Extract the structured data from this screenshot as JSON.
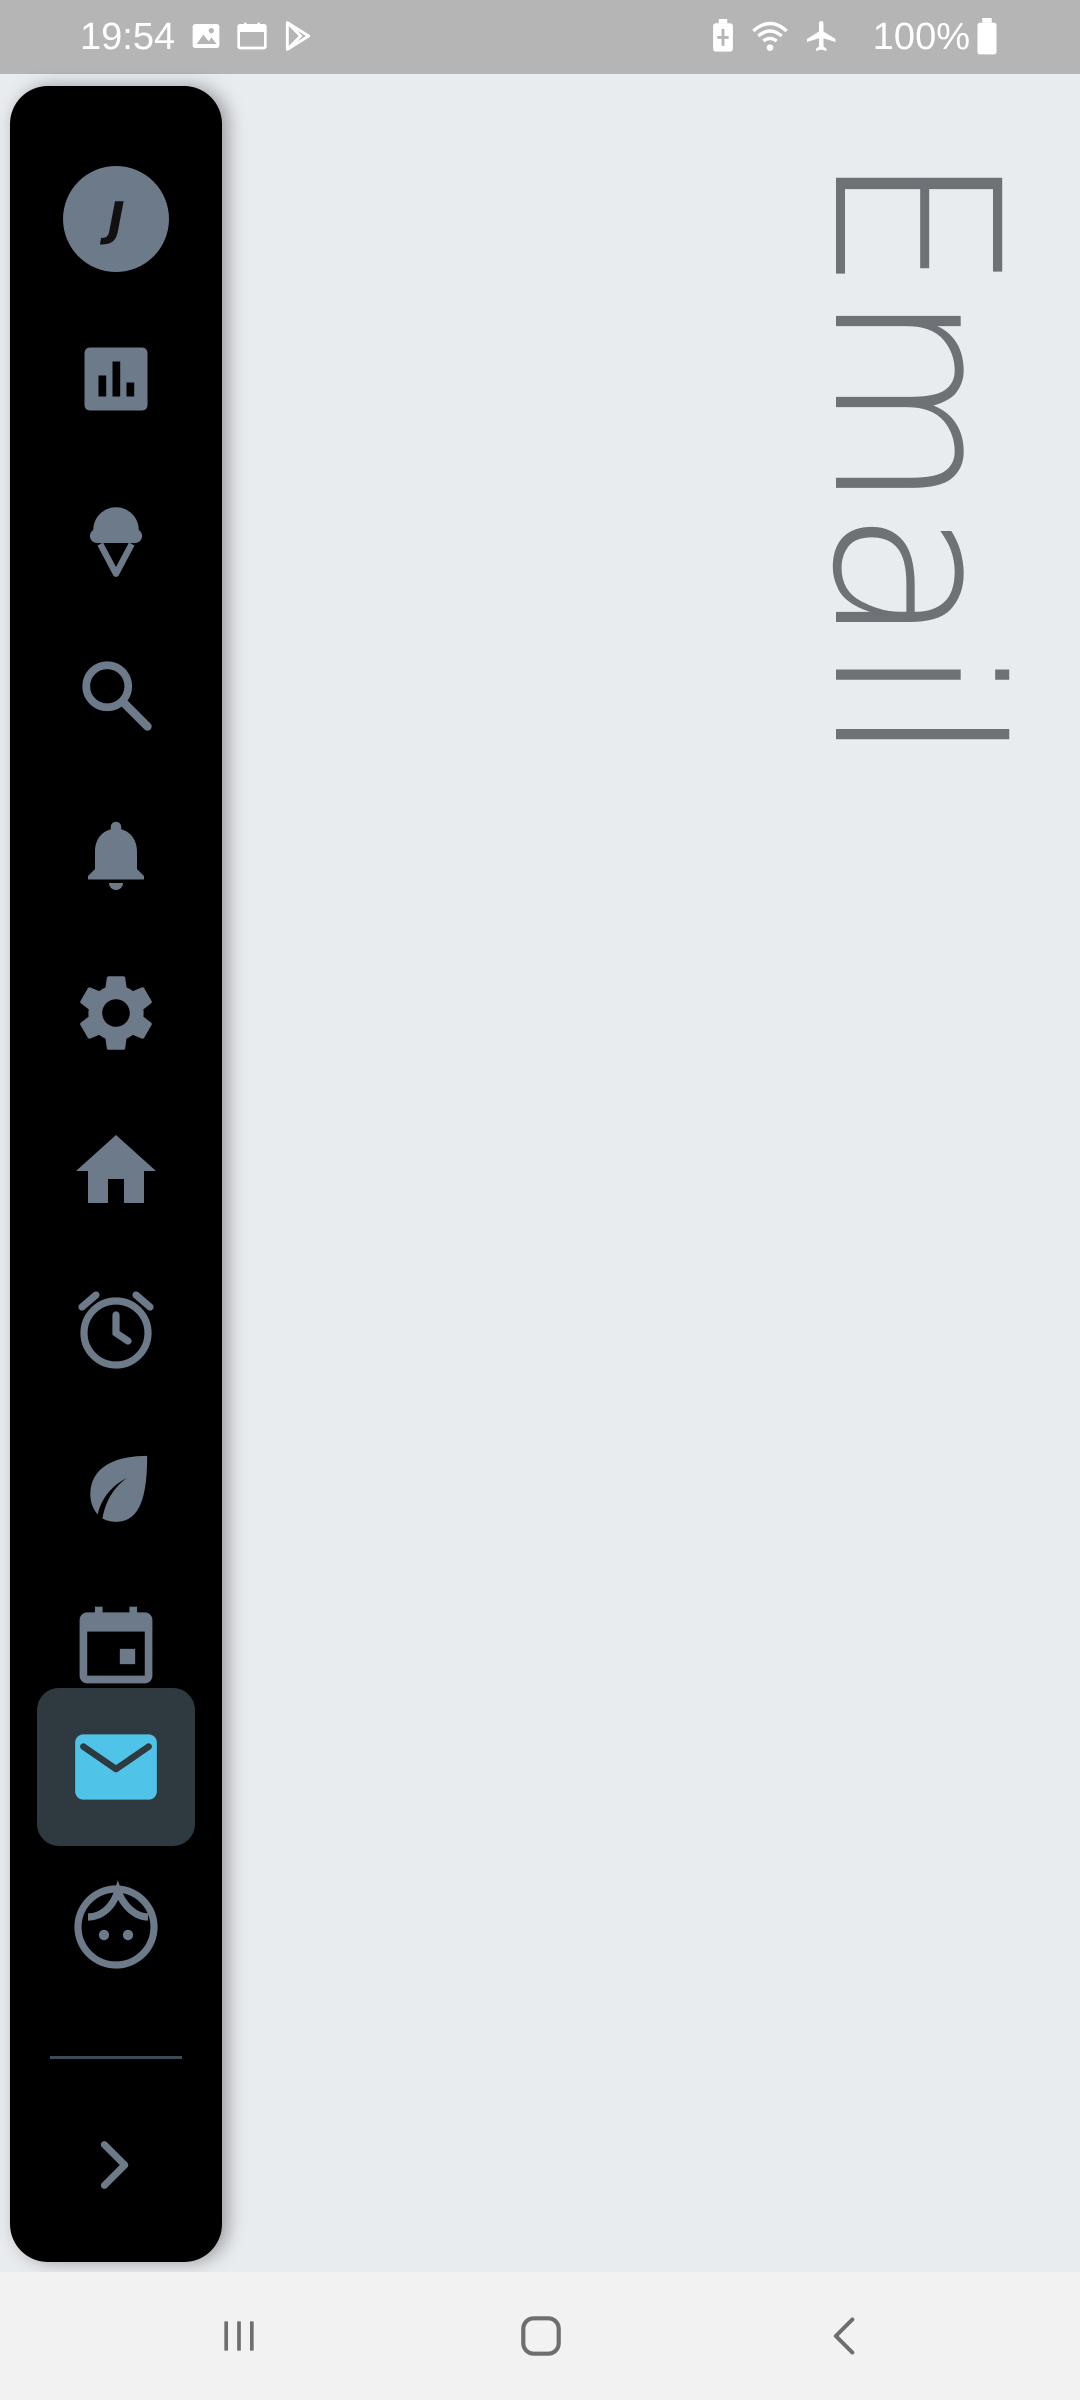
{
  "status_bar": {
    "time": "19:54",
    "battery_text": "100%",
    "left_icons": [
      "image-icon",
      "calendar-icon",
      "play-store-icon"
    ],
    "right_icons": [
      "battery-saver-icon",
      "wifi-icon",
      "airplane-mode-icon",
      "battery-icon"
    ]
  },
  "page": {
    "title": "Email"
  },
  "side_rail": {
    "avatar_letter": "J",
    "items": [
      {
        "name": "avatar",
        "icon": "avatar-icon"
      },
      {
        "name": "charts",
        "icon": "bar-chart-icon"
      },
      {
        "name": "ice-cream",
        "icon": "ice-cream-icon"
      },
      {
        "name": "search",
        "icon": "search-icon"
      },
      {
        "name": "notifications",
        "icon": "bell-icon"
      },
      {
        "name": "settings",
        "icon": "gear-icon"
      },
      {
        "name": "home",
        "icon": "home-icon"
      },
      {
        "name": "alarm",
        "icon": "alarm-clock-icon"
      },
      {
        "name": "eco",
        "icon": "leaf-icon"
      },
      {
        "name": "calendar",
        "icon": "calendar-icon"
      },
      {
        "name": "email",
        "icon": "mail-icon",
        "selected": true
      },
      {
        "name": "face",
        "icon": "face-icon"
      },
      {
        "name": "expand",
        "icon": "chevron-right-icon"
      }
    ],
    "colors": {
      "icon": "#6C7A89",
      "selected_icon": "#4FC3E8",
      "selected_bg": "#2F3A40",
      "rail_bg": "#000000"
    }
  },
  "nav_bar": {
    "buttons": [
      "recent-apps-icon",
      "home-icon",
      "back-icon"
    ]
  }
}
